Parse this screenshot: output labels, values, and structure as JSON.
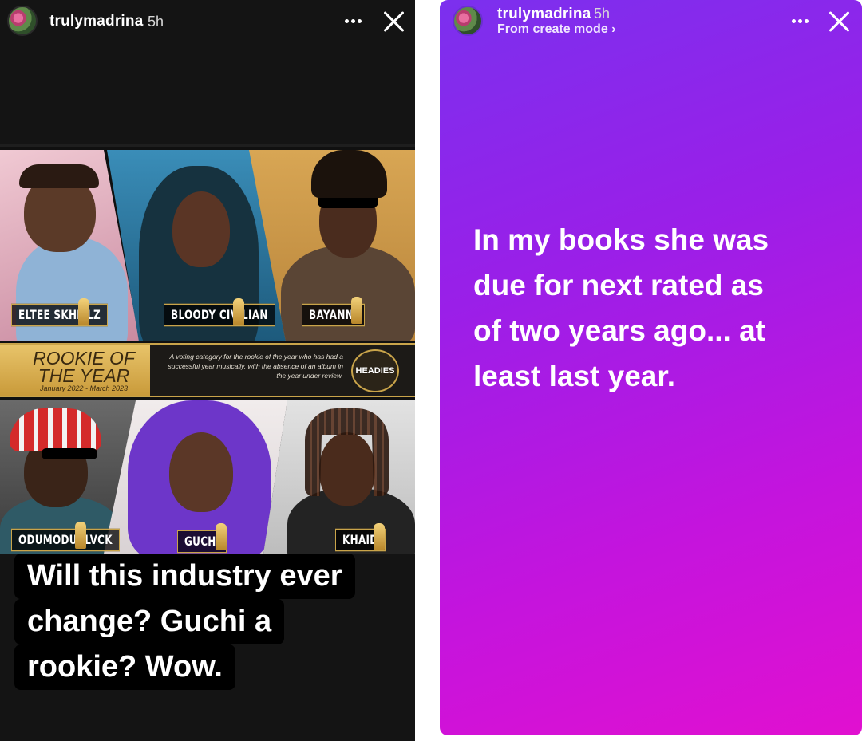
{
  "left_story": {
    "username": "trulymadrina",
    "time": "5h",
    "poster": {
      "top_names": [
        "ELTEE SKHILLZ",
        "BLOODY CIVILIAN",
        "BAYANNI"
      ],
      "bottom_names": [
        "ODUMODUBLVCK",
        "GUCHI",
        "KHAID"
      ],
      "category_title": "ROOKIE OF THE YEAR",
      "category_dates": "January 2022 - March 2023",
      "category_description": "A voting category for the rookie of the year who has had a successful year musically, with the absence of an album in the year under review.",
      "logo_text": "HEADIES"
    },
    "caption_lines": [
      "Will this industry ever",
      "change? Guchi a",
      "rookie? Wow."
    ]
  },
  "right_story": {
    "username": "trulymadrina",
    "time": "5h",
    "subline": "From create mode ›",
    "text_lines": [
      "In my books she was",
      "due for next rated as",
      "of two years ago... at",
      "least last year."
    ]
  },
  "icons": {
    "more": "more-icon",
    "close": "close-icon",
    "avatar": "avatar"
  }
}
